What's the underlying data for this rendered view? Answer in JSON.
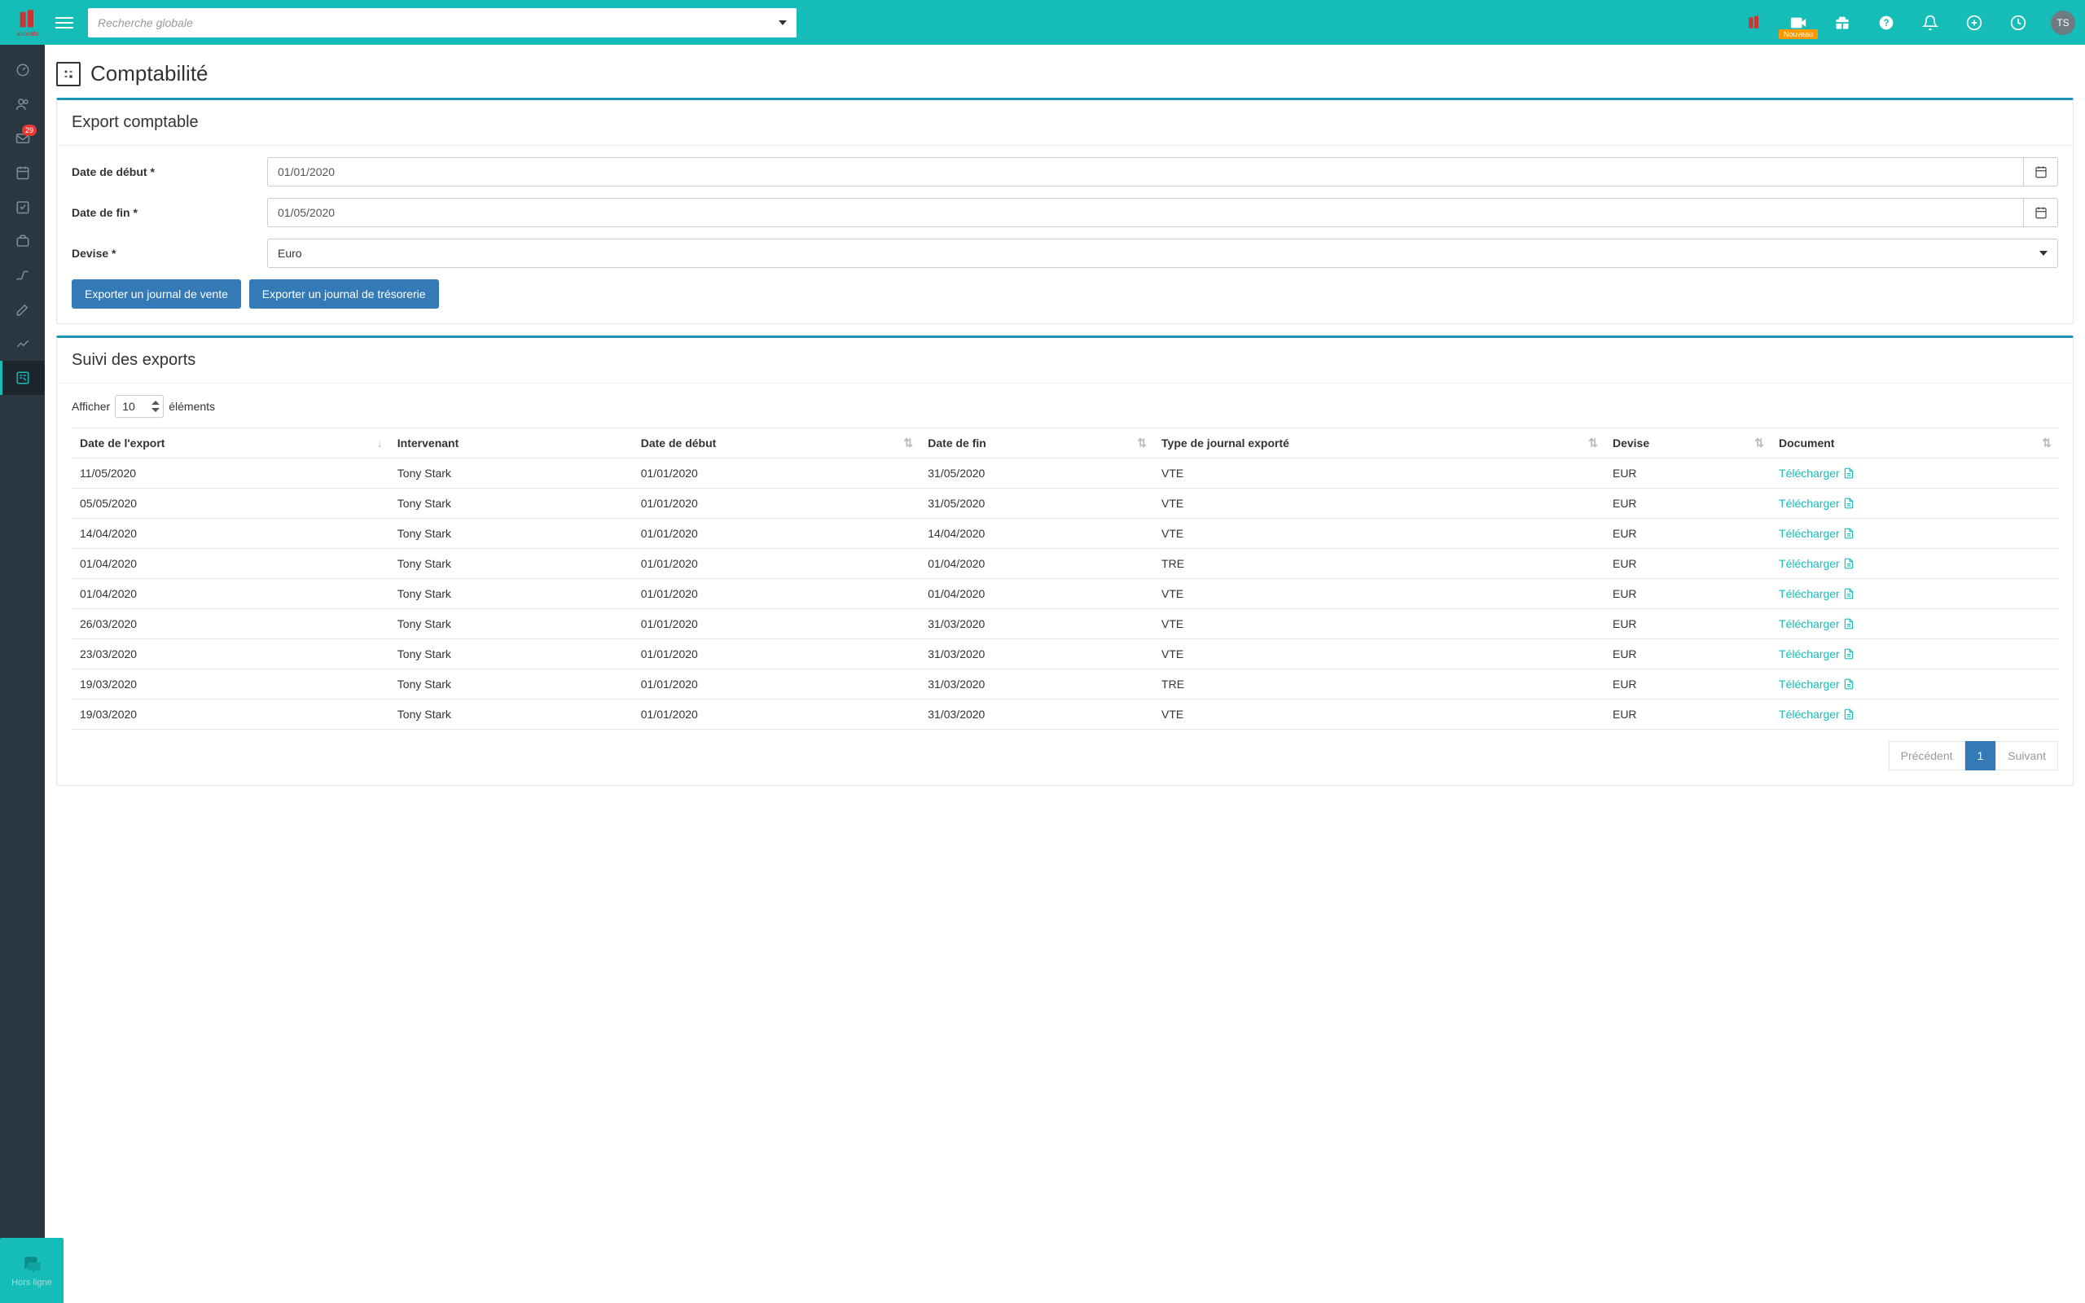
{
  "header": {
    "search_placeholder": "Recherche globale",
    "nouveau_label": "Nouveau",
    "avatar_initials": "TS"
  },
  "sidebar": {
    "badge_count": "29",
    "chat_label": "Hors ligne"
  },
  "page": {
    "title": "Comptabilité"
  },
  "export_panel": {
    "title": "Export comptable",
    "date_debut_label": "Date de début *",
    "date_debut_value": "01/01/2020",
    "date_fin_label": "Date de fin *",
    "date_fin_value": "01/05/2020",
    "devise_label": "Devise *",
    "devise_value": "Euro",
    "btn_vente": "Exporter un journal de vente",
    "btn_treso": "Exporter un journal de trésorerie"
  },
  "suivi_panel": {
    "title": "Suivi des exports",
    "length_prefix": "Afficher",
    "length_value": "10",
    "length_suffix": "éléments",
    "headers": {
      "date_export": "Date de l'export",
      "intervenant": "Intervenant",
      "date_debut": "Date de début",
      "date_fin": "Date de fin",
      "type_journal": "Type de journal exporté",
      "devise": "Devise",
      "document": "Document"
    },
    "download_label": "Télécharger",
    "rows": [
      {
        "date_export": "11/05/2020",
        "intervenant": "Tony Stark",
        "date_debut": "01/01/2020",
        "date_fin": "31/05/2020",
        "type": "VTE",
        "devise": "EUR"
      },
      {
        "date_export": "05/05/2020",
        "intervenant": "Tony Stark",
        "date_debut": "01/01/2020",
        "date_fin": "31/05/2020",
        "type": "VTE",
        "devise": "EUR"
      },
      {
        "date_export": "14/04/2020",
        "intervenant": "Tony Stark",
        "date_debut": "01/01/2020",
        "date_fin": "14/04/2020",
        "type": "VTE",
        "devise": "EUR"
      },
      {
        "date_export": "01/04/2020",
        "intervenant": "Tony Stark",
        "date_debut": "01/01/2020",
        "date_fin": "01/04/2020",
        "type": "TRE",
        "devise": "EUR"
      },
      {
        "date_export": "01/04/2020",
        "intervenant": "Tony Stark",
        "date_debut": "01/01/2020",
        "date_fin": "01/04/2020",
        "type": "VTE",
        "devise": "EUR"
      },
      {
        "date_export": "26/03/2020",
        "intervenant": "Tony Stark",
        "date_debut": "01/01/2020",
        "date_fin": "31/03/2020",
        "type": "VTE",
        "devise": "EUR"
      },
      {
        "date_export": "23/03/2020",
        "intervenant": "Tony Stark",
        "date_debut": "01/01/2020",
        "date_fin": "31/03/2020",
        "type": "VTE",
        "devise": "EUR"
      },
      {
        "date_export": "19/03/2020",
        "intervenant": "Tony Stark",
        "date_debut": "01/01/2020",
        "date_fin": "31/03/2020",
        "type": "TRE",
        "devise": "EUR"
      },
      {
        "date_export": "19/03/2020",
        "intervenant": "Tony Stark",
        "date_debut": "01/01/2020",
        "date_fin": "31/03/2020",
        "type": "VTE",
        "devise": "EUR"
      }
    ],
    "pagination": {
      "prev": "Précédent",
      "current": "1",
      "next": "Suivant"
    }
  }
}
